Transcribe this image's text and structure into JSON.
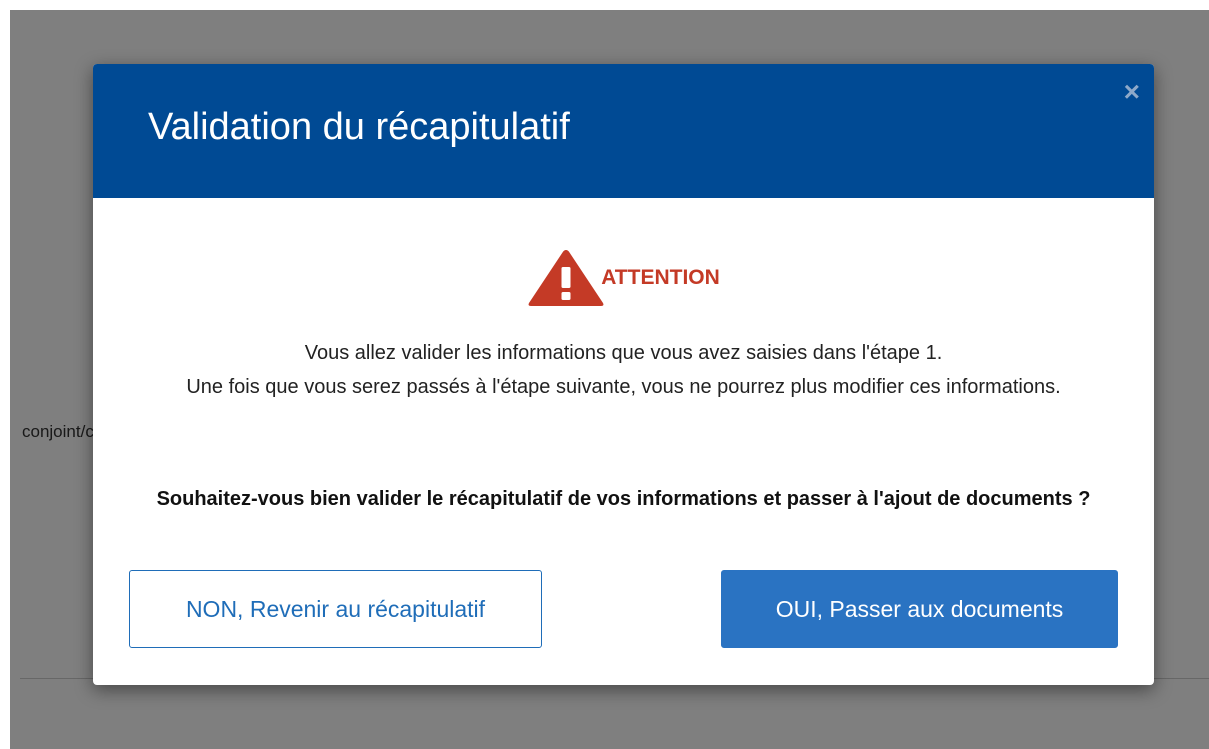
{
  "background": {
    "partial_text": "conjoint/c"
  },
  "modal": {
    "title": "Validation du récapitulatif",
    "close_symbol": "×",
    "warning": {
      "icon": "warning-triangle-icon",
      "label": "ATTENTION",
      "color": "#c43a26"
    },
    "message_line1": "Vous allez valider les informations que vous avez saisies dans l'étape 1.",
    "message_line2": "Une fois que vous serez passés à l'étape suivante, vous ne pourrez plus modifier ces informations.",
    "question": "Souhaitez-vous bien valider le récapitulatif de vos informations et passer à l'ajout de documents ?",
    "buttons": {
      "no_label": "NON, Revenir au récapitulatif",
      "yes_label": "OUI, Passer aux documents"
    },
    "colors": {
      "header": "#004a94",
      "primary": "#2a73c2"
    }
  }
}
